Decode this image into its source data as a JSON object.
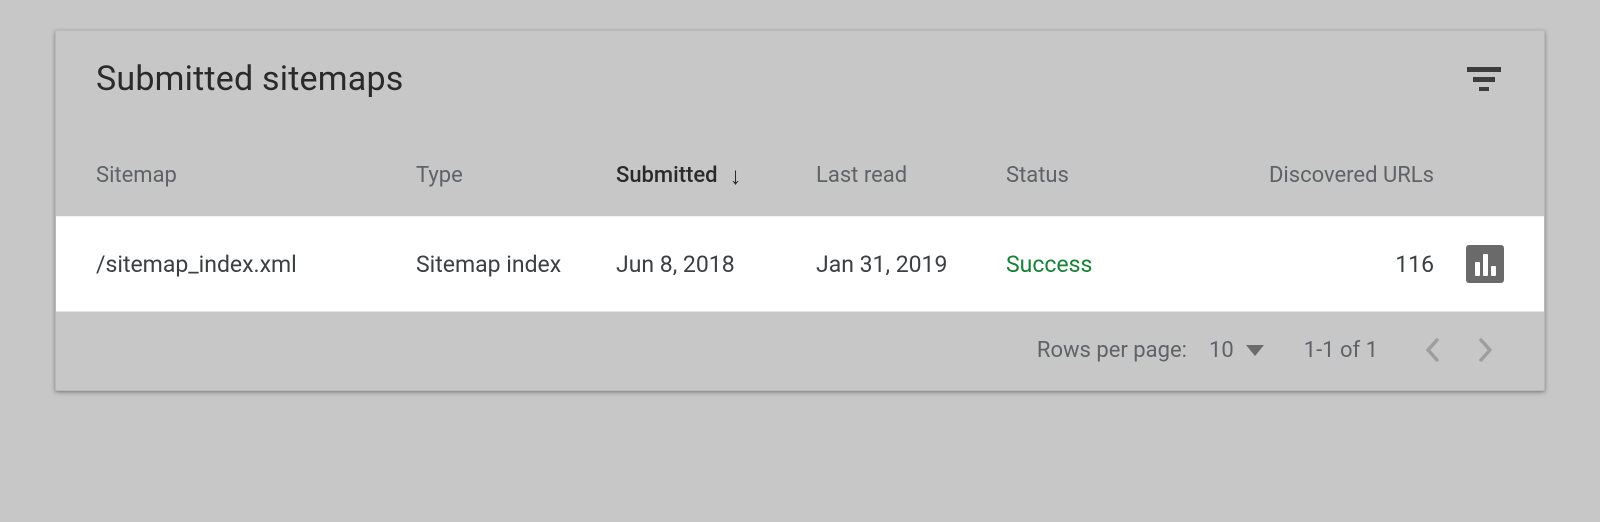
{
  "card": {
    "title": "Submitted sitemaps"
  },
  "columns": {
    "sitemap": "Sitemap",
    "type": "Type",
    "submitted": "Submitted",
    "last_read": "Last read",
    "status": "Status",
    "discovered_urls": "Discovered URLs"
  },
  "rows": [
    {
      "sitemap": "/sitemap_index.xml",
      "type": "Sitemap index",
      "submitted": "Jun 8, 2018",
      "last_read": "Jan 31, 2019",
      "status": "Success",
      "discovered_urls": "116"
    }
  ],
  "pagination": {
    "rows_per_page_label": "Rows per page:",
    "rows_per_page_value": "10",
    "range": "1-1 of 1"
  }
}
